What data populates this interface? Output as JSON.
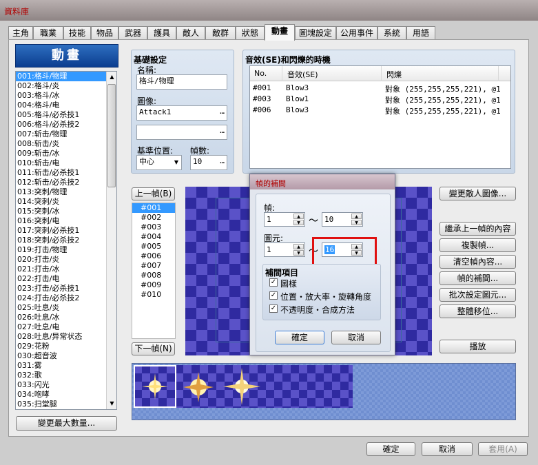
{
  "window": {
    "title": "資料庫"
  },
  "tabs": [
    "主角",
    "職業",
    "技能",
    "物品",
    "武器",
    "護具",
    "敵人",
    "敵群",
    "狀態",
    "動畫",
    "圖塊設定",
    "公用事件",
    "系統",
    "用語"
  ],
  "left": {
    "heading": "動畫",
    "items": [
      "001:格斗/物理",
      "002:格斗/炎",
      "003:格斗/冰",
      "004:格斗/电",
      "005:格斗/必杀技1",
      "006:格斗/必杀技2",
      "007:斩击/物理",
      "008:斩击/炎",
      "009:斩击/冰",
      "010:斩击/电",
      "011:斩击/必杀技1",
      "012:斩击/必杀技2",
      "013:突刺/物理",
      "014:突刺/炎",
      "015:突刺/冰",
      "016:突刺/电",
      "017:突刺/必杀技1",
      "018:突刺/必杀技2",
      "019:打击/物理",
      "020:打击/炎",
      "021:打击/冰",
      "022:打击/电",
      "023:打击/必杀技1",
      "024:打击/必杀技2",
      "025:吐息/炎",
      "026:吐息/冰",
      "027:吐息/电",
      "028:吐息/异常状态",
      "029:花粉",
      "030:超音波",
      "031:雾",
      "032:歌",
      "033:闪光",
      "034:咆哮",
      "035:扫堂腿"
    ],
    "max_button": "變更最大數量..."
  },
  "basic": {
    "title": "基礎設定",
    "name_label": "名稱:",
    "name_value": "格斗/物理",
    "image_label": "圖像:",
    "image1": "Attack1",
    "image2": "",
    "position_label": "基準位置:",
    "position_value": "中心",
    "frames_label": "幀數:",
    "frames_value": "10"
  },
  "se": {
    "title": "音效(SE)和閃爍的時機",
    "headers": [
      "No.",
      "音效(SE)",
      "閃爍"
    ],
    "rows": [
      [
        "#001",
        "Blow3",
        "對象 (255,255,255,221), @1"
      ],
      [
        "#003",
        "Blow1",
        "對象 (255,255,255,221), @1"
      ],
      [
        "#006",
        "Blow3",
        "對象 (255,255,255,221), @1"
      ]
    ]
  },
  "frames": {
    "prev": "上一幀(B)",
    "next": "下一幀(N)",
    "items": [
      "#001",
      "#002",
      "#003",
      "#004",
      "#005",
      "#006",
      "#007",
      "#008",
      "#009",
      "#010"
    ]
  },
  "right_buttons": [
    "變更敵人圖像...",
    "繼承上一幀的內容",
    "複製幀...",
    "清空幀內容...",
    "幀的補間...",
    "批次設定圖元...",
    "整體移位...",
    "播放"
  ],
  "dialog": {
    "title": "幀的補間",
    "frame_label": "幀:",
    "frame_from": "1",
    "frame_to": "10",
    "cell_label": "圖元:",
    "cell_from": "1",
    "cell_to": "16",
    "tilde": "～",
    "group_title": "補間項目",
    "opts": [
      "圖樣",
      "位置・放大率・旋轉角度",
      "不透明度・合成方法"
    ],
    "ok": "確定",
    "cancel": "取消"
  },
  "bottom": {
    "ok": "確定",
    "cancel": "取消",
    "apply": "套用(A)"
  },
  "colors": {
    "highlight": "#e01010",
    "selection": "#3399ff"
  }
}
